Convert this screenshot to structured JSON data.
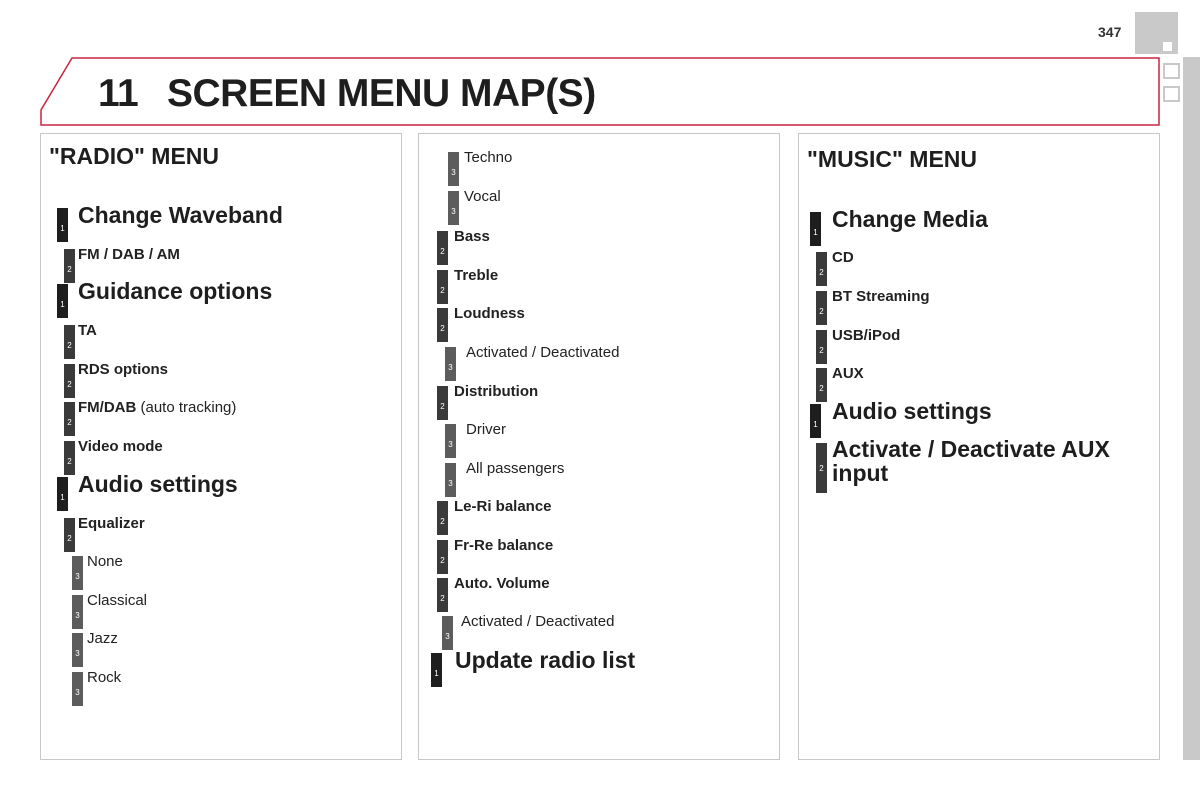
{
  "page": {
    "number": "347",
    "chapter_number": "11",
    "chapter_title": "SCREEN MENU MAP(S)",
    "accent_color": "#c8253f"
  },
  "radio_menu": {
    "heading": "\"RADIO\" MENU",
    "items": [
      {
        "level": "1",
        "label": "Change Waveband"
      },
      {
        "level": "2",
        "label": "FM / DAB / AM"
      },
      {
        "level": "1",
        "label": "Guidance options"
      },
      {
        "level": "2",
        "label": "TA"
      },
      {
        "level": "2",
        "label": "RDS options"
      },
      {
        "level": "2",
        "label": "FM/DAB",
        "suffix": " (auto tracking)"
      },
      {
        "level": "2",
        "label": "Video mode"
      },
      {
        "level": "1",
        "label": "Audio settings"
      },
      {
        "level": "2",
        "label": "Equalizer"
      },
      {
        "level": "3",
        "label": "None"
      },
      {
        "level": "3",
        "label": "Classical"
      },
      {
        "level": "3",
        "label": "Jazz"
      },
      {
        "level": "3",
        "label": "Rock"
      }
    ]
  },
  "radio_menu_continued": {
    "items": [
      {
        "level": "3",
        "label": "Techno"
      },
      {
        "level": "3",
        "label": "Vocal"
      },
      {
        "level": "2",
        "label": "Bass"
      },
      {
        "level": "2",
        "label": "Treble"
      },
      {
        "level": "2",
        "label": "Loudness"
      },
      {
        "level": "3",
        "label": "Activated / Deactivated"
      },
      {
        "level": "2",
        "label": "Distribution"
      },
      {
        "level": "3",
        "label": "Driver"
      },
      {
        "level": "3",
        "label": "All passengers"
      },
      {
        "level": "2",
        "label": "Le-Ri balance"
      },
      {
        "level": "2",
        "label": "Fr-Re balance"
      },
      {
        "level": "2",
        "label": "Auto. Volume"
      },
      {
        "level": "3",
        "label": "Activated / Deactivated"
      },
      {
        "level": "1",
        "label": "Update radio list"
      }
    ]
  },
  "music_menu": {
    "heading": "\"MUSIC\" MENU",
    "items": [
      {
        "level": "1",
        "label": "Change Media"
      },
      {
        "level": "2",
        "label": "CD"
      },
      {
        "level": "2",
        "label": "BT Streaming"
      },
      {
        "level": "2",
        "label": "USB/iPod"
      },
      {
        "level": "2",
        "label": "AUX"
      },
      {
        "level": "1",
        "label": "Audio settings"
      },
      {
        "level": "2",
        "label": "Activate / Deactivate AUX input"
      }
    ]
  }
}
